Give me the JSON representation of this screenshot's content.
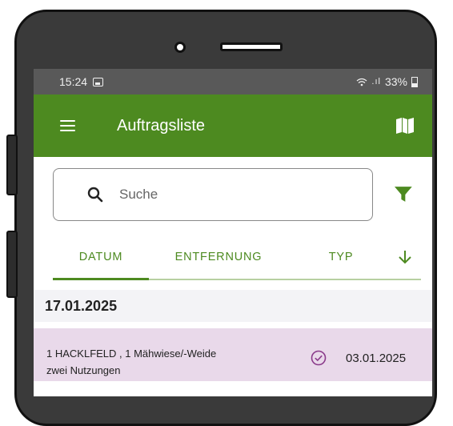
{
  "status_bar": {
    "time": "15:24",
    "signal": ".ıl",
    "battery": "33%"
  },
  "app_bar": {
    "title": "Auftragsliste"
  },
  "search": {
    "placeholder": "Suche",
    "value": ""
  },
  "tabs": [
    {
      "label": "DATUM",
      "selected": true
    },
    {
      "label": "ENTFERNUNG",
      "selected": false
    },
    {
      "label": "TYP",
      "selected": false
    }
  ],
  "list": {
    "group_date": "17.01.2025",
    "items": [
      {
        "title": "1 HACKLFELD , 1 Mähwiese/-Weide",
        "subtitle": "zwei Nutzungen",
        "date": "03.01.2025"
      }
    ]
  },
  "colors": {
    "primary": "#4d8a20",
    "status_bar": "#595959",
    "item_bg": "#e9d9ea",
    "check": "#8b3b8b"
  },
  "icons": [
    "menu-icon",
    "map-icon",
    "search-icon",
    "filter-icon",
    "sort-arrow-down-icon",
    "check-circle-icon"
  ]
}
